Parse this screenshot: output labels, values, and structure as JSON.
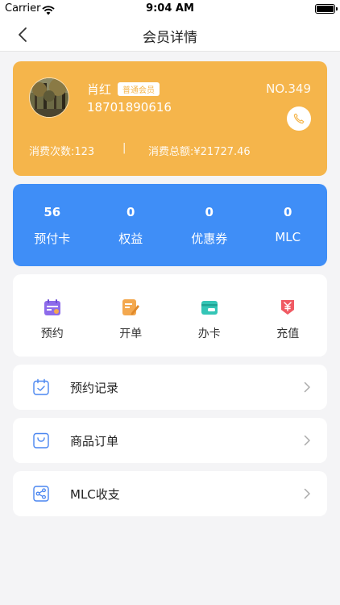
{
  "status_bar": {
    "carrier": "Carrier",
    "time": "9:04 AM"
  },
  "nav": {
    "title": "会员详情"
  },
  "member": {
    "name": "肖红",
    "level": "普通会员",
    "number": "NO.349",
    "phone": "18701890616",
    "visit_count": "消费次数:123",
    "separator": "|",
    "total_spent": "消费总额:¥21727.46"
  },
  "assets": [
    {
      "value": "56",
      "label": "预付卡"
    },
    {
      "value": "0",
      "label": "权益"
    },
    {
      "value": "0",
      "label": "优惠券"
    },
    {
      "value": "0",
      "label": "MLC"
    }
  ],
  "actions": [
    {
      "label": "预约",
      "icon": "calendar-icon",
      "color": "#8d6bea"
    },
    {
      "label": "开单",
      "icon": "order-edit-icon",
      "color": "#f3a84f"
    },
    {
      "label": "办卡",
      "icon": "card-icon",
      "color": "#34c5b6"
    },
    {
      "label": "充值",
      "icon": "yen-recharge-icon",
      "color": "#f05a63"
    }
  ],
  "menu": [
    {
      "label": "预约记录",
      "icon": "calendar-check-icon"
    },
    {
      "label": "商品订单",
      "icon": "shopping-bag-icon"
    },
    {
      "label": "MLC收支",
      "icon": "share-icon"
    }
  ],
  "colors": {
    "member_card": "#f5b54b",
    "assets_card": "#3f8ef7",
    "outline_icon": "#4a86f0"
  }
}
